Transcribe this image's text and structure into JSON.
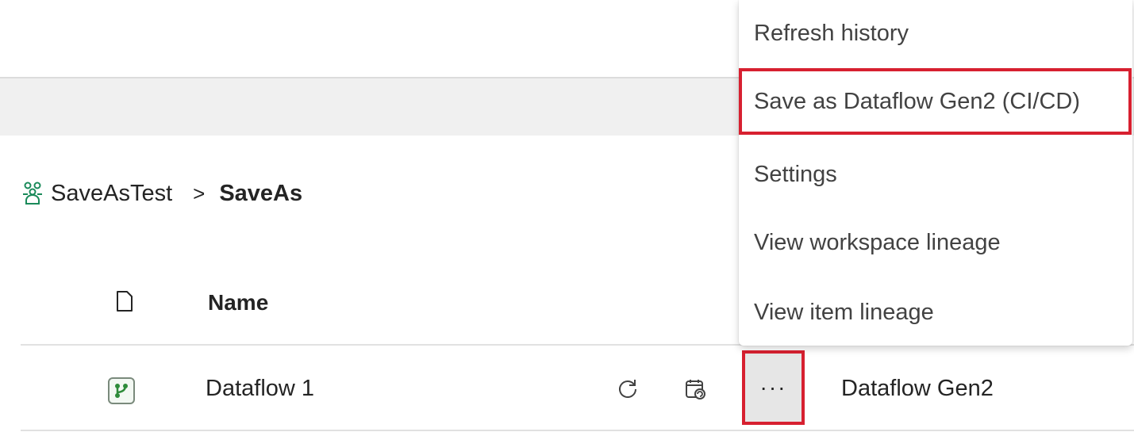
{
  "breadcrumb": {
    "workspace": "SaveAsTest",
    "separator": ">",
    "current": "SaveAs"
  },
  "table": {
    "header_name": "Name",
    "rows": [
      {
        "name": "Dataflow 1",
        "type": "Dataflow Gen2",
        "icon": "dataflow-icon"
      }
    ]
  },
  "row_actions": {
    "more_label": "···"
  },
  "context_menu": {
    "items": [
      {
        "label": "Refresh history"
      },
      {
        "label": "Save as Dataflow Gen2 (CI/CD)"
      },
      {
        "label": "Settings"
      },
      {
        "label": "View workspace lineage"
      },
      {
        "label": "View item lineage"
      }
    ]
  },
  "colors": {
    "highlight_border": "#d72030",
    "workspace_icon": "#1a8a5a",
    "dataflow_icon": "#2e8b3a"
  }
}
